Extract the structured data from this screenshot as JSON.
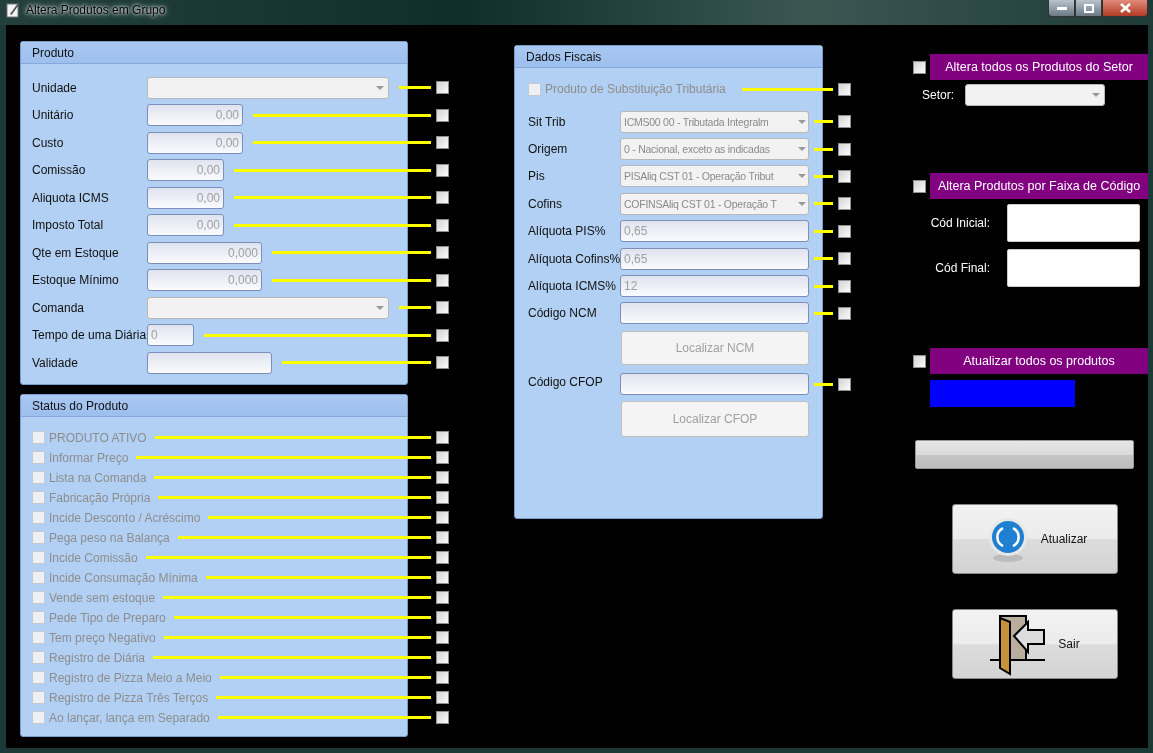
{
  "window": {
    "title": "Altera Produtos em Grupo"
  },
  "produto": {
    "title": "Produto",
    "fields": [
      {
        "label": "Unidade",
        "kind": "combo",
        "apply_checked": false
      },
      {
        "label": "Unitário",
        "kind": "number",
        "value": "0,00",
        "apply_checked": false
      },
      {
        "label": "Custo",
        "kind": "number",
        "value": "0,00",
        "apply_checked": false
      },
      {
        "label": "Comissão",
        "kind": "number",
        "value": "0,00",
        "apply_checked": false
      },
      {
        "label": "Aliquota ICMS",
        "kind": "number",
        "value": "0,00",
        "apply_checked": false
      },
      {
        "label": "Imposto Total",
        "kind": "number",
        "value": "0,00",
        "apply_checked": false
      },
      {
        "label": "Qte em Estoque",
        "kind": "number",
        "value": "0,000",
        "apply_checked": false
      },
      {
        "label": "Estoque Mínimo",
        "kind": "number",
        "value": "0,000",
        "apply_checked": false
      },
      {
        "label": "Comanda",
        "kind": "combo",
        "apply_checked": false
      },
      {
        "label": "Tempo de uma Diária",
        "kind": "text",
        "value": "0",
        "apply_checked": false
      },
      {
        "label": "Validade",
        "kind": "text",
        "apply_checked": false
      }
    ]
  },
  "status": {
    "title": "Status do Produto",
    "items": [
      {
        "label": "PRODUTO ATIVO",
        "checked": false,
        "disabled": true,
        "apply_checked": false
      },
      {
        "label": "Informar Preço",
        "checked": false,
        "disabled": true,
        "apply_checked": false
      },
      {
        "label": "Lista na Comanda",
        "checked": false,
        "disabled": true,
        "apply_checked": false
      },
      {
        "label": "Fabricação Própria",
        "checked": false,
        "disabled": true,
        "apply_checked": false
      },
      {
        "label": "Incide Desconto / Acréscimo",
        "checked": false,
        "disabled": true,
        "apply_checked": false
      },
      {
        "label": "Pega peso na Balança",
        "checked": false,
        "disabled": true,
        "apply_checked": false
      },
      {
        "label": "Incide Comissão",
        "checked": false,
        "disabled": true,
        "apply_checked": false
      },
      {
        "label": "Incide Consumação Mínima",
        "checked": false,
        "disabled": true,
        "apply_checked": false
      },
      {
        "label": "Vende sem estoque",
        "checked": false,
        "disabled": true,
        "apply_checked": false
      },
      {
        "label": "Pede Tipo de Preparo",
        "checked": false,
        "disabled": true,
        "apply_checked": false
      },
      {
        "label": "Tem preço Negativo",
        "checked": false,
        "disabled": true,
        "apply_checked": false
      },
      {
        "label": "Registro de Diária",
        "checked": false,
        "disabled": true,
        "apply_checked": false
      },
      {
        "label": "Registro de Pizza Meio a Meio",
        "checked": false,
        "disabled": true,
        "apply_checked": false
      },
      {
        "label": "Registro de Pizza Três Terços",
        "checked": false,
        "disabled": true,
        "apply_checked": false
      },
      {
        "label": "Ao lançar, lança em Separado",
        "checked": false,
        "disabled": true,
        "apply_checked": false
      }
    ]
  },
  "fiscal": {
    "title": "Dados Fiscais",
    "rows": [
      {
        "kind": "check",
        "label": "Produto de Substituição Tributária",
        "checked": false,
        "disabled": true,
        "apply_checked": false
      },
      {
        "kind": "combo",
        "label": "Sit Trib",
        "value": "ICMS00 00 - Tributada Integralm",
        "apply_checked": false
      },
      {
        "kind": "combo",
        "label": "Origem",
        "value": "0 - Nacional, exceto as indicadas",
        "apply_checked": false
      },
      {
        "kind": "combo",
        "label": "Pis",
        "value": "PISAliq CST 01 - Operação Tribut",
        "apply_checked": false
      },
      {
        "kind": "combo",
        "label": "Cofins",
        "value": "COFINSAliq CST 01 - Operação T",
        "apply_checked": false
      },
      {
        "kind": "text",
        "label": "Alíquota PIS%",
        "value": "0,65",
        "apply_checked": false
      },
      {
        "kind": "text",
        "label": "Alíquota Cofins%",
        "value": "0,65",
        "apply_checked": false
      },
      {
        "kind": "text",
        "label": "Alíquota ICMS%",
        "value": "12",
        "apply_checked": false
      },
      {
        "kind": "text",
        "label": "Código NCM",
        "apply_checked": false
      },
      {
        "kind": "button",
        "label": "Localizar NCM",
        "disabled": true
      },
      {
        "kind": "text",
        "label": "Código CFOP",
        "apply_checked": false
      },
      {
        "kind": "button",
        "label": "Localizar CFOP",
        "disabled": true
      }
    ]
  },
  "options": {
    "setor": {
      "title": "Altera todos os Produtos do Setor",
      "checked": false,
      "field_label": "Setor:"
    },
    "faixa": {
      "title": "Altera Produtos por Faixa de Código",
      "checked": false,
      "start_label": "Cód Inicial:",
      "end_label": "Cód Final:"
    },
    "todos": {
      "title": "Atualizar todos os produtos",
      "checked": false
    }
  },
  "progress": {
    "level": 0
  },
  "buttons": [
    {
      "kind": "refresh",
      "label": "Atualizar"
    },
    {
      "kind": "exit",
      "label": "Sair"
    }
  ]
}
